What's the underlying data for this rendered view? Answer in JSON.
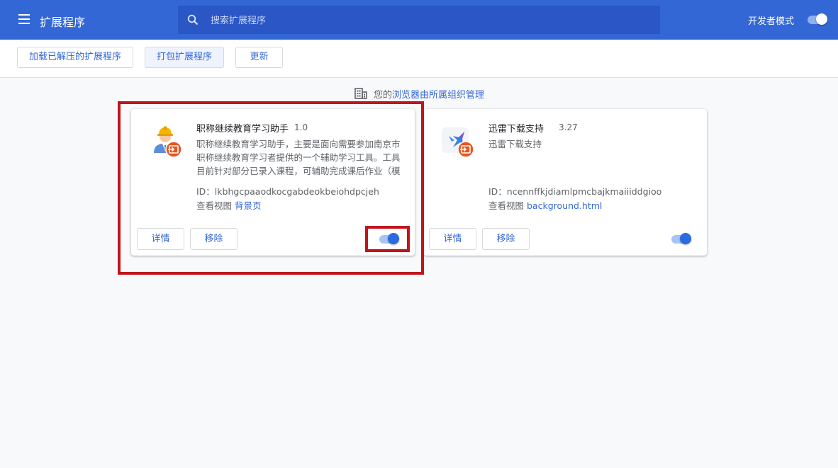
{
  "header": {
    "title": "扩展程序",
    "search": {
      "placeholder": "搜索扩展程序",
      "value": ""
    },
    "developer_mode": {
      "label": "开发者模式",
      "enabled": true
    }
  },
  "toolbar": {
    "load_unpacked": "加载已解压的扩展程序",
    "pack": "打包扩展程序",
    "update": "更新"
  },
  "managed_notice": {
    "prefix": "您的",
    "link": "浏览器由所属组织管理"
  },
  "extensions": [
    {
      "name": "职称继续教育学习助手",
      "version": "1.0",
      "description": "职称继续教育学习助手，主要是面向需要参加南京市职称继续教育学习者提供的一个辅助学习工具。工具目前针对部分已录入课程，可辅助完成课后作业（模拟）已录入课程列表",
      "id_text": "ID：lkbhgcpaaodkocgabdeokbeiohdpcjeh",
      "views_label": "查看视图",
      "view_link": "背景页",
      "details_label": "详情",
      "remove_label": "移除",
      "enabled": true
    },
    {
      "name": "迅雷下载支持",
      "version": "3.27",
      "description": "迅雷下载支持",
      "id_text": "ID：ncennffkjdiamlpmcbajkmaiiiddgioo",
      "views_label": "查看视图",
      "view_link": "background.html",
      "details_label": "详情",
      "remove_label": "移除",
      "enabled": true
    }
  ],
  "colors": {
    "header_bg": "#3367d6",
    "accent": "#3367d6",
    "highlight": "#c0151b",
    "policy_badge": "#e8551f"
  },
  "icons": [
    "menu-icon",
    "search-icon",
    "building-icon",
    "worker-icon",
    "thunder-bird-icon",
    "policy-badge-icon"
  ]
}
